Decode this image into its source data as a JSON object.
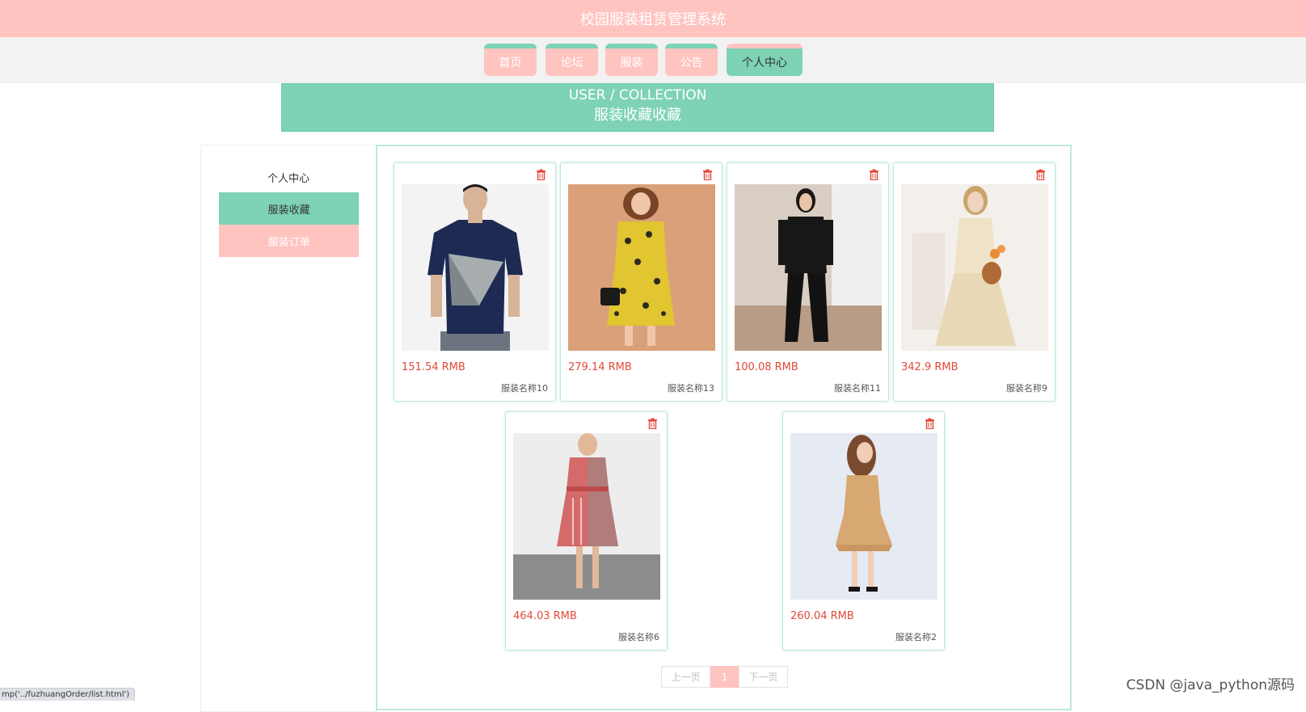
{
  "header": {
    "title": "校园服装租赁管理系统"
  },
  "nav": {
    "items": [
      {
        "label": "首页"
      },
      {
        "label": "论坛"
      },
      {
        "label": "服装"
      },
      {
        "label": "公告"
      },
      {
        "label": "个人中心",
        "active": true
      }
    ]
  },
  "hero": {
    "en_title": "USER / COLLECTION",
    "cn_title": "服装收藏收藏"
  },
  "sidebar": {
    "title": "个人中心",
    "items": [
      {
        "label": "服装收藏",
        "active": true
      },
      {
        "label": "服装订单",
        "active": false
      }
    ]
  },
  "collection": {
    "items": [
      {
        "price": "151.54 RMB",
        "name": "服装名称10",
        "delete_icon": "trash-icon"
      },
      {
        "price": "279.14 RMB",
        "name": "服装名称13",
        "delete_icon": "trash-icon"
      },
      {
        "price": "100.08 RMB",
        "name": "服装名称11",
        "delete_icon": "trash-icon"
      },
      {
        "price": "342.9 RMB",
        "name": "服装名称9",
        "delete_icon": "trash-icon"
      },
      {
        "price": "464.03 RMB",
        "name": "服装名称6",
        "delete_icon": "trash-icon"
      },
      {
        "price": "260.04 RMB",
        "name": "服装名称2",
        "delete_icon": "trash-icon"
      }
    ]
  },
  "pagination": {
    "prev": "上一页",
    "current": "1",
    "next": "下一页"
  },
  "status_bar": {
    "url": "mp('../fuzhuangOrder/list.html')"
  },
  "watermark": "CSDN @java_python源码",
  "colors": {
    "pink": "#ffc4c0",
    "mint": "#7dd3b4",
    "price_red": "#e2493a"
  }
}
